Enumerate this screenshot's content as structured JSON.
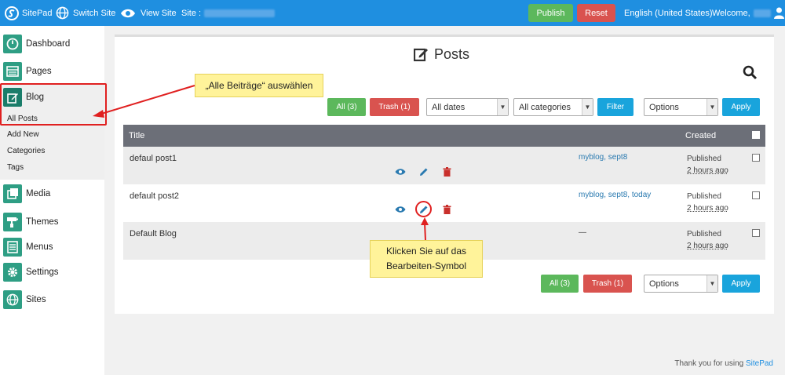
{
  "topbar": {
    "brand": "SitePad",
    "switch_site": "Switch Site",
    "view_site": "View Site",
    "site_label": "Site :",
    "publish": "Publish",
    "reset": "Reset",
    "language": "English (United States)",
    "welcome": "Welcome,"
  },
  "sidebar": {
    "items": [
      {
        "label": "Dashboard",
        "icon": "dashboard-icon"
      },
      {
        "label": "Pages",
        "icon": "pages-icon"
      },
      {
        "label": "Blog",
        "icon": "blog-icon"
      },
      {
        "label": "Media",
        "icon": "media-icon"
      },
      {
        "label": "Themes",
        "icon": "themes-icon"
      },
      {
        "label": "Menus",
        "icon": "menus-icon"
      },
      {
        "label": "Settings",
        "icon": "settings-icon"
      },
      {
        "label": "Sites",
        "icon": "sites-icon"
      }
    ],
    "blog_sub": [
      "All Posts",
      "Add New",
      "Categories",
      "Tags"
    ]
  },
  "main": {
    "title": "Posts",
    "all_btn": "All (3)",
    "trash_btn": "Trash (1)",
    "dates_select": "All dates",
    "categories_select": "All categories",
    "filter_btn": "Filter",
    "options_select": "Options",
    "apply_btn": "Apply",
    "columns": {
      "title": "Title",
      "created": "Created"
    },
    "rows": [
      {
        "title": "defaul post1",
        "categories": "myblog, sept8",
        "status": "Published",
        "ago": "2 hours ago"
      },
      {
        "title": "default post2",
        "categories": "myblog, sept8, today",
        "status": "Published",
        "ago": "2 hours ago"
      },
      {
        "title": "Default Blog",
        "categories": "—",
        "status": "Published",
        "ago": "2 hours ago"
      }
    ]
  },
  "footer": {
    "text": "Thank you for using",
    "link": "SitePad"
  },
  "annotations": {
    "callout1": "„Alle Beiträge“ auswählen",
    "callout2_line1": "Klicken Sie auf das",
    "callout2_line2": "Bearbeiten-Symbol"
  },
  "colors": {
    "topbar": "#1f8fe0",
    "sidebar_icon": "#2e9e84",
    "accent_red": "#e02020",
    "callout": "#fff39a"
  }
}
